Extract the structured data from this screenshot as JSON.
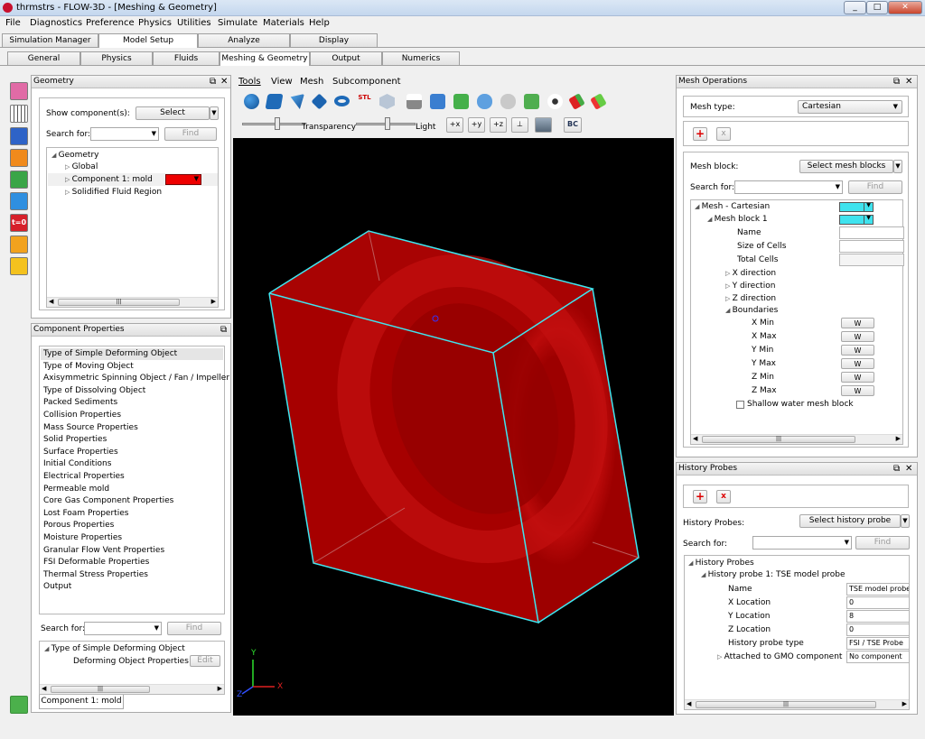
{
  "window": {
    "title": "thrmstrs - FLOW-3D - [Meshing & Geometry]",
    "min": "_",
    "max": "□",
    "close": "✕"
  },
  "menu": [
    "File",
    "Diagnostics",
    "Preference",
    "Physics",
    "Utilities",
    "Simulate",
    "Materials",
    "Help"
  ],
  "main_tabs": [
    "Simulation Manager",
    "Model Setup",
    "Analyze",
    "Display"
  ],
  "sub_tabs": [
    "General",
    "Physics",
    "Fluids",
    "Meshing & Geometry",
    "Output",
    "Numerics"
  ],
  "geometry": {
    "title": "Geometry",
    "show_label": "Show component(s):",
    "select_label": "Select",
    "search_label": "Search for:",
    "find_label": "Find",
    "tree": {
      "root": "Geometry",
      "global": "Global",
      "component": "Component 1: mold",
      "solidified": "Solidified Fluid Region"
    },
    "component_color": "#ee0000"
  },
  "component_properties": {
    "title": "Component Properties",
    "items": [
      "Type of Simple Deforming Object",
      "Type of Moving Object",
      "Axisymmetric Spinning Object / Fan / Impeller",
      "Type of Dissolving Object",
      "Packed Sediments",
      "Collision Properties",
      "Mass Source Properties",
      "Solid Properties",
      "Surface Properties",
      "Initial Conditions",
      "Electrical Properties",
      "Permeable mold",
      "Core Gas Component Properties",
      "Lost Foam Properties",
      "Porous Properties",
      "Moisture Properties",
      "Granular Flow Vent Properties",
      "FSI Deformable Properties",
      "Thermal Stress Properties",
      "Output"
    ],
    "search_label": "Search for:",
    "find_label": "Find",
    "sub_tree_root": "Type of Simple Deforming Object",
    "sub_tree_child": "Deforming Object Properties",
    "edit_label": "Edit",
    "bottom_tab": "Component 1: mold"
  },
  "viewport": {
    "menu": [
      "Tools",
      "View",
      "Mesh",
      "Subcomponent"
    ],
    "transparency_label": "Transparency",
    "light_label": "Light",
    "axis_buttons": [
      "+x",
      "+y",
      "+z"
    ],
    "bc_label": "BC",
    "axis_x": "X",
    "axis_y": "Y",
    "axis_z": "Z",
    "stl_label": "STL"
  },
  "mesh_operations": {
    "title": "Mesh Operations",
    "mesh_type_label": "Mesh type:",
    "mesh_type_value": "Cartesian",
    "mesh_block_label": "Mesh block:",
    "select_blocks_label": "Select  mesh blocks",
    "search_label": "Search for:",
    "find_label": "Find",
    "tree": {
      "root": "Mesh - Cartesian",
      "block": "Mesh block 1",
      "name": "Name",
      "size_of_cells": "Size of Cells",
      "total_cells": "Total Cells",
      "x_dir": "X direction",
      "y_dir": "Y direction",
      "z_dir": "Z direction",
      "boundaries": "Boundaries",
      "xmin": "X Min",
      "xmax": "X Max",
      "ymin": "Y Min",
      "ymax": "Y Max",
      "zmin": "Z Min",
      "zmax": "Z Max",
      "w_label": "W",
      "shallow": "Shallow water mesh block"
    },
    "add_symbol": "+",
    "remove_symbol": "x"
  },
  "history_probes": {
    "title": "History Probes",
    "probes_label": "History Probes:",
    "select_label": "Select  history probe",
    "search_label": "Search for:",
    "find_label": "Find",
    "tree": {
      "root": "History Probes",
      "probe": "History probe 1: TSE model probe",
      "name_label": "Name",
      "name_value": "TSE model probe",
      "x_label": "X Location",
      "x_value": "0",
      "y_label": "Y Location",
      "y_value": "8",
      "z_label": "Z Location",
      "z_value": "0",
      "type_label": "History probe type",
      "type_value": "FSI / TSE Probe",
      "gmo_label": "Attached to GMO component",
      "gmo_value": "No component"
    },
    "add_symbol": "+",
    "remove_symbol": "x"
  },
  "left_toolbar_icons": [
    "geometry-icon",
    "mesh-icon",
    "list-icon",
    "waveform-icon",
    "probe-icon",
    "spring-icon",
    "time-zero-icon",
    "box-icon",
    "chart-icon"
  ]
}
